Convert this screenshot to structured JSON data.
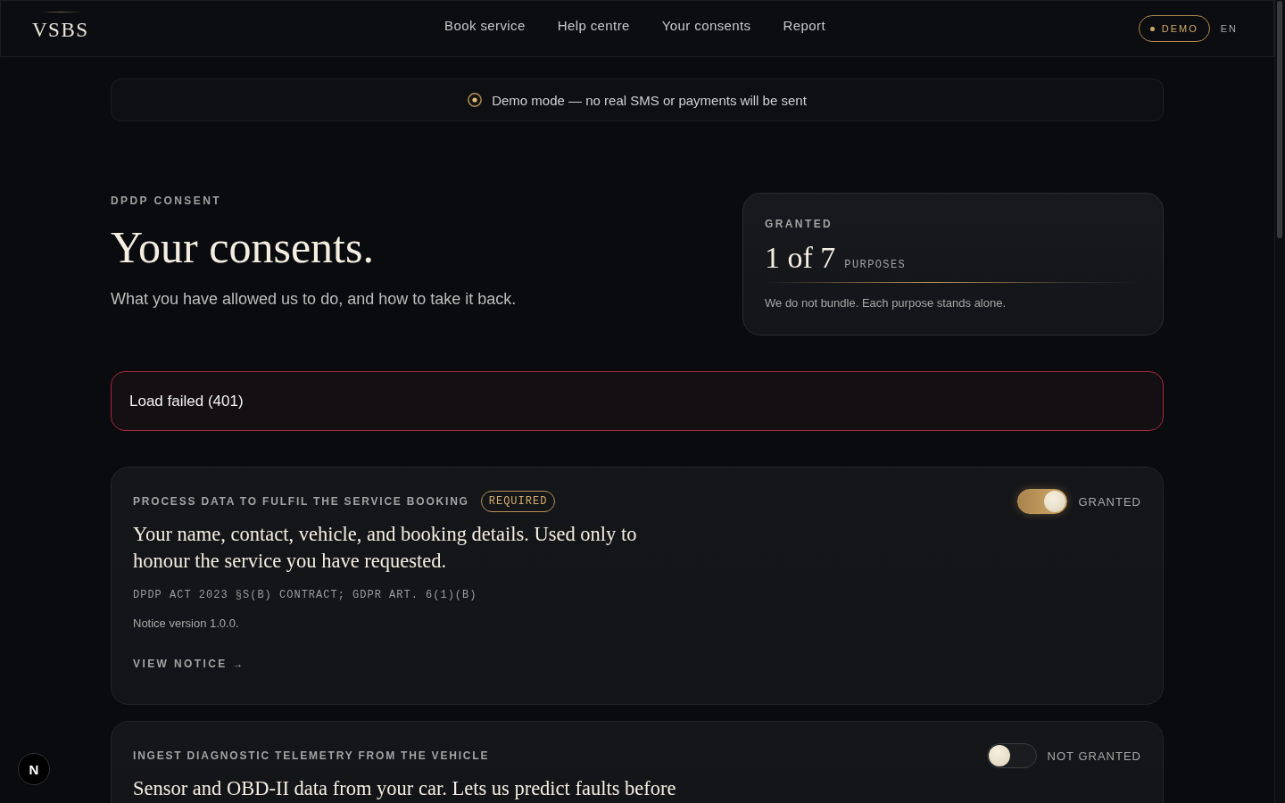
{
  "header": {
    "logo": "VSBS",
    "nav": [
      "Book service",
      "Help centre",
      "Your consents",
      "Report"
    ],
    "demo_badge": "DEMO",
    "language": "EN"
  },
  "banner": {
    "text": "Demo mode — no real SMS or payments will be sent"
  },
  "hero": {
    "eyebrow": "DPDP CONSENT",
    "title": "Your consents.",
    "subtitle": "What you have allowed us to do, and how to take it back."
  },
  "summary": {
    "label": "GRANTED",
    "count": "1 of 7",
    "unit": "PURPOSES",
    "note": "We do not bundle. Each purpose stands alone."
  },
  "error": {
    "message": "Load failed (401)"
  },
  "purposes": [
    {
      "title": "PROCESS DATA TO FULFIL THE SERVICE BOOKING",
      "badge": "REQUIRED",
      "granted": true,
      "status": "GRANTED",
      "description": "Your name, contact, vehicle, and booking details. Used only to honour the service you have requested.",
      "legal_basis": "DPDP ACT 2023 §S(B) CONTRACT; GDPR ART. 6(1)(B)",
      "notice_version": "Notice version 1.0.0.",
      "link": "VIEW NOTICE →"
    },
    {
      "title": "INGEST DIAGNOSTIC TELEMETRY FROM THE VEHICLE",
      "granted": false,
      "status": "NOT GRANTED",
      "description": "Sensor and OBD-II data from your car. Lets us predict faults before"
    }
  ],
  "dev_badge": {
    "label": "N"
  }
}
